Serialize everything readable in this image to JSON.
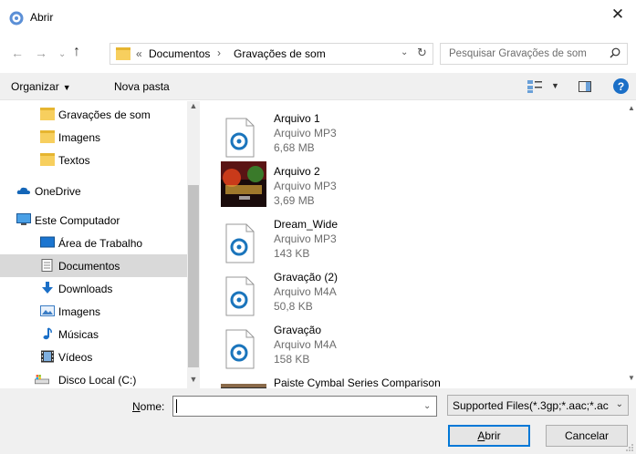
{
  "window": {
    "title": "Abrir",
    "close": "✕"
  },
  "nav": {
    "back": "←",
    "forward": "→",
    "recent": "⌄",
    "up": "↑",
    "path_chevron": "«",
    "path": [
      "Documentos",
      "Gravações de som"
    ],
    "path_sep": "›",
    "dropdown": "⌄",
    "refresh": "↻"
  },
  "search": {
    "placeholder": "Pesquisar Gravações de som"
  },
  "toolbar": {
    "organize_label": "Organizar",
    "organize_arrow": "▼",
    "new_folder_label": "Nova pasta",
    "view_arrow": "▼",
    "help": "?"
  },
  "sidebar": {
    "items": [
      {
        "label": "Gravações de som",
        "icon": "folder-icon"
      },
      {
        "label": "Imagens",
        "icon": "folder-icon"
      },
      {
        "label": "Textos",
        "icon": "folder-icon"
      },
      {
        "label": "OneDrive",
        "icon": "cloud-icon"
      },
      {
        "label": "Este Computador",
        "icon": "computer-icon"
      },
      {
        "label": "Área de Trabalho",
        "icon": "desktop-icon"
      },
      {
        "label": "Documentos",
        "icon": "documents-icon",
        "selected": true
      },
      {
        "label": "Downloads",
        "icon": "download-icon"
      },
      {
        "label": "Imagens",
        "icon": "pictures-icon"
      },
      {
        "label": "Músicas",
        "icon": "music-icon"
      },
      {
        "label": "Vídeos",
        "icon": "video-icon"
      },
      {
        "label": "Disco Local (C:)",
        "icon": "drive-icon"
      }
    ],
    "scroll_up": "▲",
    "scroll_down": "▼"
  },
  "files": [
    {
      "name": "Arquivo 1",
      "type": "Arquivo MP3",
      "size": "6,68 MB",
      "thumb": "audio"
    },
    {
      "name": "Arquivo 2",
      "type": "Arquivo MP3",
      "size": "3,69 MB",
      "thumb": "album-art"
    },
    {
      "name": "Dream_Wide",
      "type": "Arquivo MP3",
      "size": "143 KB",
      "thumb": "audio"
    },
    {
      "name": "Gravação (2)",
      "type": "Arquivo M4A",
      "size": "50,8 KB",
      "thumb": "audio"
    },
    {
      "name": "Gravação",
      "type": "Arquivo M4A",
      "size": "158 KB",
      "thumb": "audio"
    },
    {
      "name": "Paiste Cymbal Series Comparison",
      "type": "",
      "size": "",
      "thumb": "album-art"
    }
  ],
  "filelist_scroll": {
    "up": "▲",
    "down": "▼"
  },
  "bottom": {
    "name_label_u": "N",
    "name_label_rest": "ome:",
    "name_value": "",
    "name_drop": "⌄",
    "filter_label": "Supported Files(*.3gp;*.aac;*.ac",
    "filter_drop": "⌄",
    "open_u": "A",
    "open_rest": "brir",
    "cancel_label": "Cancelar"
  },
  "colors": {
    "accent": "#0078d7",
    "folder": "#f7cf5e",
    "selection": "#d9d9d9",
    "audio_icon": "#1b75bc"
  }
}
